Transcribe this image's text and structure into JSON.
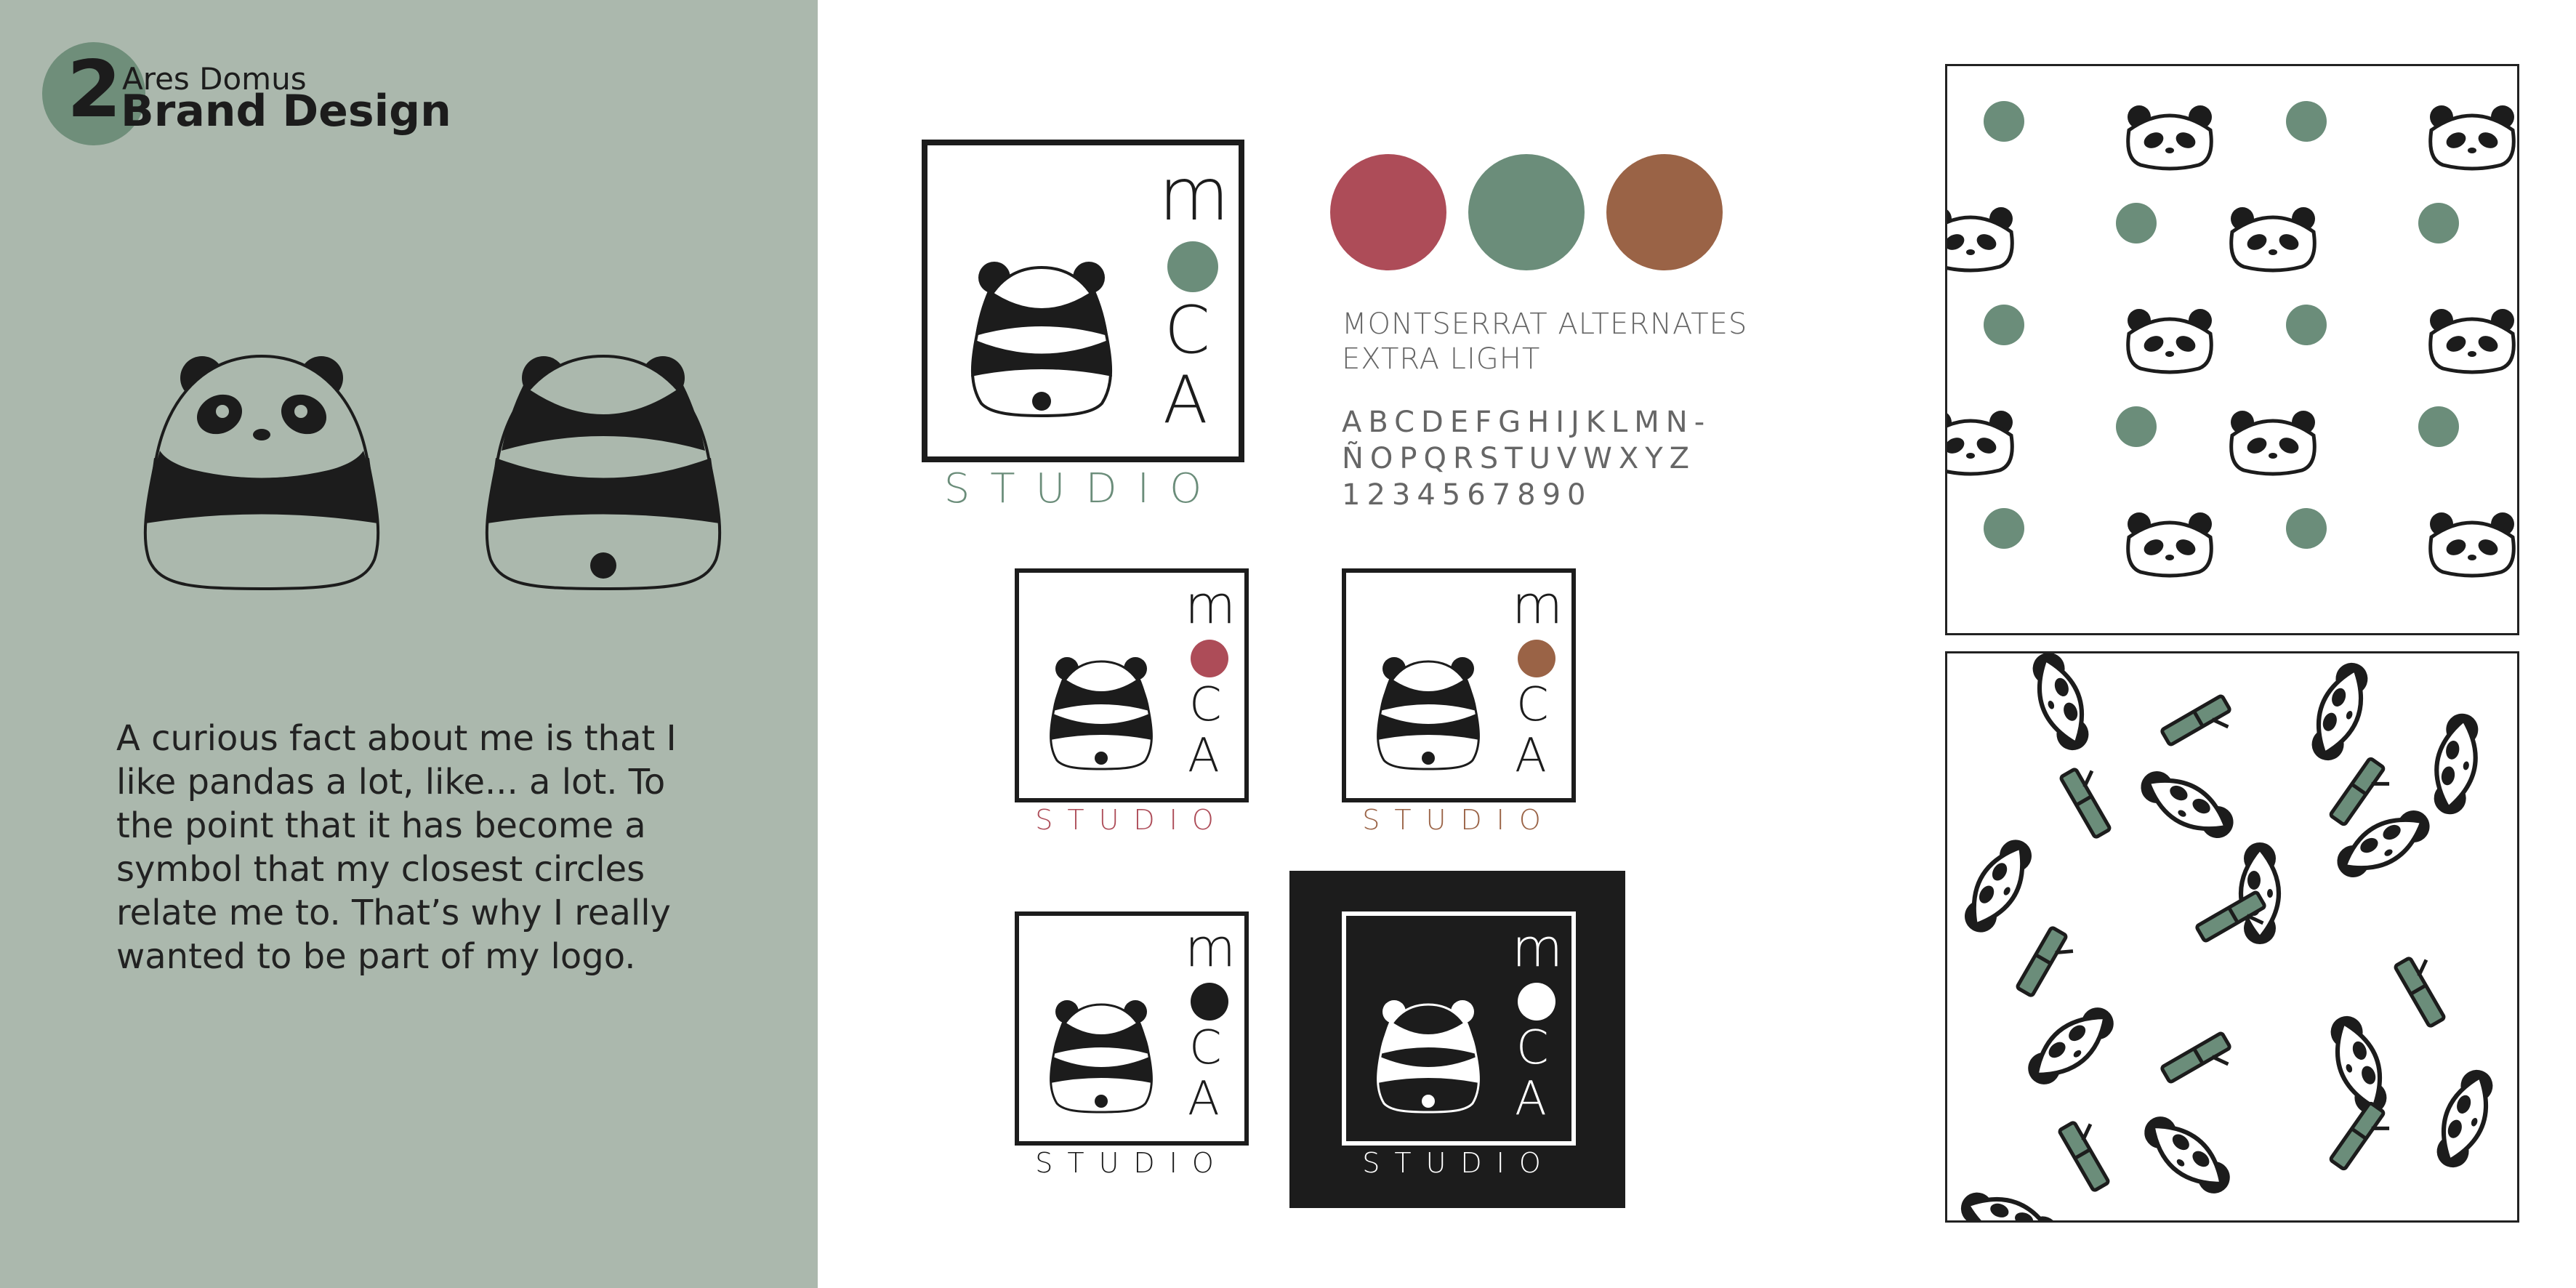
{
  "header": {
    "number": "2",
    "subtitle": "Ares Domus",
    "title": "Brand Design"
  },
  "description": "A curious fact about me is that I like pandas a lot, like... a lot. To the point that it has become a symbol that my closest circles relate me to. That’s why I really wanted to be part of my logo.",
  "logo": {
    "letters": [
      "m",
      "C",
      "A"
    ],
    "studio": "STUDIO"
  },
  "palette": {
    "red": "#ad4c58",
    "green": "#6b8d7a",
    "brown": "#9a6346"
  },
  "typography": {
    "font_name_line1": "MONTSERRAT ALTERNATES",
    "font_name_line2": "EXTRA LIGHT",
    "alphabet_line1": "ABCDEFGHIJKLMN-",
    "alphabet_line2": "ÑOPQRSTUVWXYZ",
    "digits": "1234567890"
  }
}
